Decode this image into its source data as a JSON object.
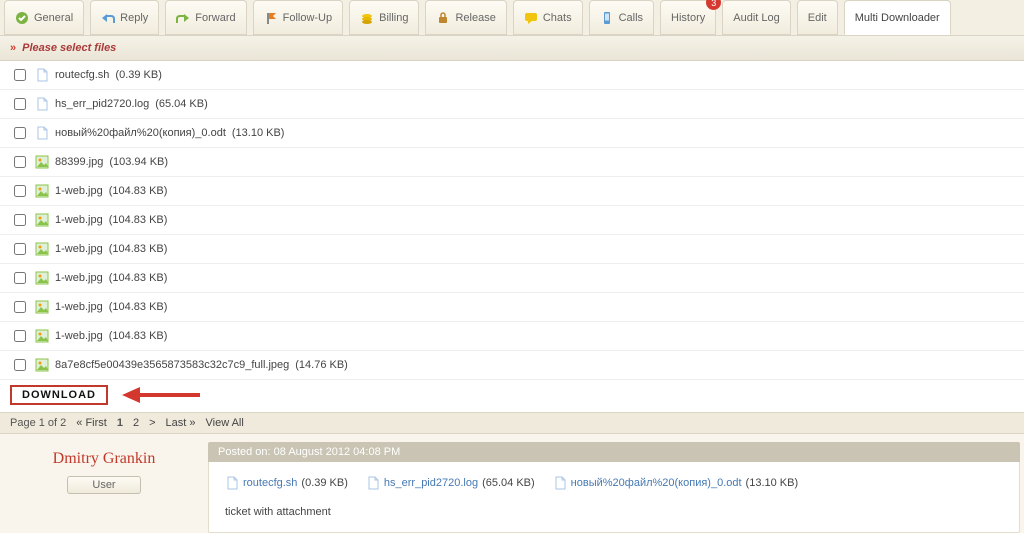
{
  "tabs": [
    {
      "label": "General",
      "icon": "check"
    },
    {
      "label": "Reply",
      "icon": "reply"
    },
    {
      "label": "Forward",
      "icon": "forward"
    },
    {
      "label": "Follow-Up",
      "icon": "flag"
    },
    {
      "label": "Billing",
      "icon": "coins"
    },
    {
      "label": "Release",
      "icon": "lock"
    },
    {
      "label": "Chats",
      "icon": "chat"
    },
    {
      "label": "Calls",
      "icon": "phone"
    },
    {
      "label": "History",
      "icon": "",
      "badge": "3"
    },
    {
      "label": "Audit Log",
      "icon": ""
    },
    {
      "label": "Edit",
      "icon": ""
    },
    {
      "label": "Multi Downloader",
      "icon": "",
      "active": true
    }
  ],
  "subbar": {
    "label": "Please select files"
  },
  "files": [
    {
      "name": "routecfg.sh",
      "size": "(0.39 KB)",
      "kind": "doc"
    },
    {
      "name": "hs_err_pid2720.log",
      "size": "(65.04 KB)",
      "kind": "doc"
    },
    {
      "name": "новый%20файл%20(копия)_0.odt",
      "size": "(13.10 KB)",
      "kind": "doc"
    },
    {
      "name": "88399.jpg",
      "size": "(103.94 KB)",
      "kind": "img"
    },
    {
      "name": "1-web.jpg",
      "size": "(104.83 KB)",
      "kind": "img"
    },
    {
      "name": "1-web.jpg",
      "size": "(104.83 KB)",
      "kind": "img"
    },
    {
      "name": "1-web.jpg",
      "size": "(104.83 KB)",
      "kind": "img"
    },
    {
      "name": "1-web.jpg",
      "size": "(104.83 KB)",
      "kind": "img"
    },
    {
      "name": "1-web.jpg",
      "size": "(104.83 KB)",
      "kind": "img"
    },
    {
      "name": "1-web.jpg",
      "size": "(104.83 KB)",
      "kind": "img"
    },
    {
      "name": "8a7e8cf5e00439e3565873583c32c7c9_full.jpeg",
      "size": "(14.76 KB)",
      "kind": "img"
    }
  ],
  "download_label": "DOWNLOAD",
  "pager": {
    "summary": "Page 1 of 2",
    "first": "« First",
    "p1": "1",
    "p2": "2",
    "next": ">",
    "last": "Last »",
    "viewall": "View All"
  },
  "post": {
    "user_name": "Dmitry Grankin",
    "user_role": "User",
    "header": "Posted on: 08 August 2012 04:08 PM",
    "attachments": [
      {
        "name": "routecfg.sh",
        "size": "(0.39 KB)"
      },
      {
        "name": "hs_err_pid2720.log",
        "size": "(65.04 KB)"
      },
      {
        "name": "новый%20файл%20(копия)_0.odt",
        "size": "(13.10 KB)"
      }
    ],
    "message": "ticket with attachment"
  }
}
